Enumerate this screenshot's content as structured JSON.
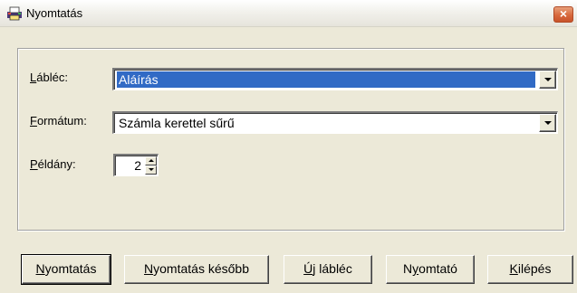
{
  "window": {
    "title": "Nyomtatás",
    "icon": "printer-app-icon",
    "close_label": "×"
  },
  "form": {
    "footer": {
      "label_accel": "L",
      "label_rest": "ábléc:",
      "value": "Aláírás"
    },
    "format": {
      "label_accel": "F",
      "label_rest": "ormátum:",
      "value": "Számla kerettel sűrű"
    },
    "copies": {
      "label_accel": "P",
      "label_rest": "éldány:",
      "value": "2"
    }
  },
  "buttons": {
    "print": {
      "accel": "N",
      "rest": "yomtatás"
    },
    "print_later": {
      "accel": "N",
      "rest": "yomtatás később"
    },
    "new_footer": {
      "accel": "Ú",
      "rest": "j lábléc"
    },
    "printer": {
      "pre": "N",
      "accel": "y",
      "rest": "omtató"
    },
    "exit": {
      "accel": "K",
      "rest": "ilépés"
    }
  },
  "colors": {
    "selection": "#316ac5",
    "dialog_bg": "#ece9d8",
    "close_button": "#d7683c"
  }
}
